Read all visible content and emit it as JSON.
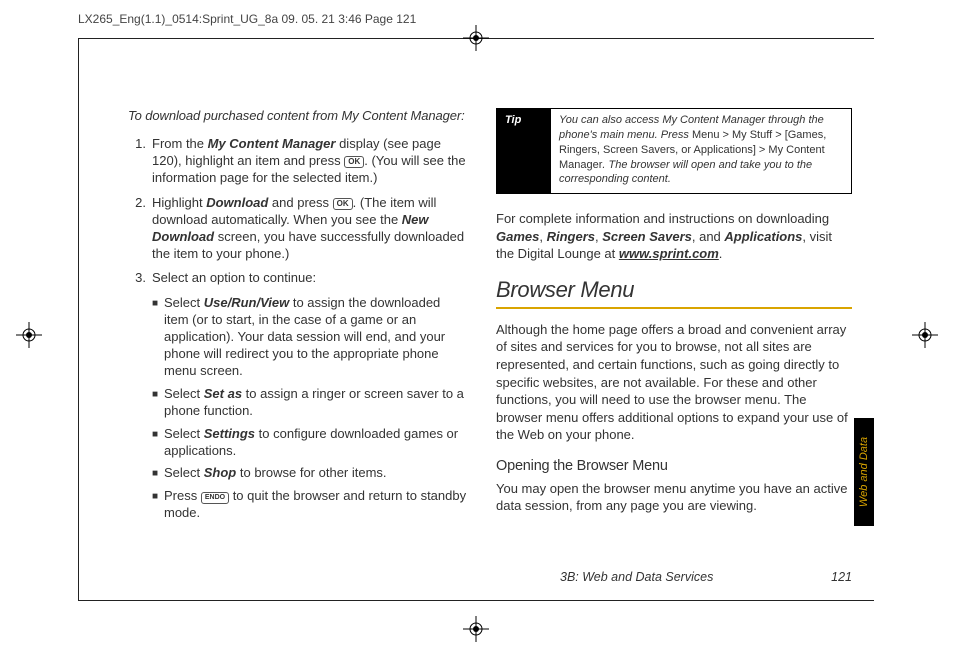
{
  "header": "LX265_Eng(1.1)_0514:Sprint_UG_8a  09. 05. 21    3:46  Page 121",
  "left": {
    "intro": "To download purchased content from My Content Manager:",
    "step1_a": "From the ",
    "step1_b": "My Content Manager",
    "step1_c": " display (see page 120), highlight an item and press ",
    "step1_d": ". (You will see the information page for the selected item.)",
    "step2_a": "Highlight ",
    "step2_b": "Download",
    "step2_c": " and press ",
    "step2_d": ". (The item will download automatically. When you see the ",
    "step2_e": "New Download",
    "step2_f": " screen, you have successfully downloaded the item to your phone.)",
    "step3": "Select an option to continue:",
    "b1_a": "Select ",
    "b1_b": "Use/Run/View",
    "b1_c": " to assign the downloaded item (or to start, in the case of a game or an application). Your data session will end, and your phone will redirect you to the appropriate phone menu screen.",
    "b2_a": "Select ",
    "b2_b": "Set as",
    "b2_c": " to assign a ringer or screen saver to a phone function.",
    "b3_a": "Select ",
    "b3_b": "Settings",
    "b3_c": " to configure downloaded games or applications.",
    "b4_a": "Select ",
    "b4_b": "Shop",
    "b4_c": " to browse for other items.",
    "b5_a": "Press ",
    "b5_b": " to quit the browser and return to standby mode."
  },
  "right": {
    "tip_label": "Tip",
    "tip_a": "You can also access My Content Manager through the phone's main menu. Press ",
    "tip_b": "Menu > My Stuff > ",
    "tip_c": "[Games, Ringers, Screen Savers, or Applications]",
    "tip_d": " > My Content Manager",
    "tip_e": ". The browser will open and take you to the corresponding content.",
    "p1_a": "For complete information and instructions on downloading ",
    "p1_b": "Games",
    "p1_c": ", ",
    "p1_d": "Ringers",
    "p1_e": ", ",
    "p1_f": "Screen Savers",
    "p1_g": ", and ",
    "p1_h": "Applications",
    "p1_i": ", visit the Digital Lounge at ",
    "p1_j": "www.sprint.com",
    "p1_k": ".",
    "section": "Browser Menu",
    "p2": "Although the home page offers a broad and convenient array of sites and services for you to browse, not all sites are represented, and certain functions, such as going directly to specific websites, are not available. For these and other functions, you will need to use the browser menu. The browser menu offers additional options to expand your use of the Web on your phone.",
    "sub": "Opening the Browser Menu",
    "p3": "You may open the browser menu anytime you have an active data session, from any page you are viewing."
  },
  "footer": {
    "section": "3B: Web and Data Services",
    "page": "121"
  },
  "sidetab": "Web and Data",
  "keys": {
    "ok": "OK",
    "end": "ENDO"
  }
}
